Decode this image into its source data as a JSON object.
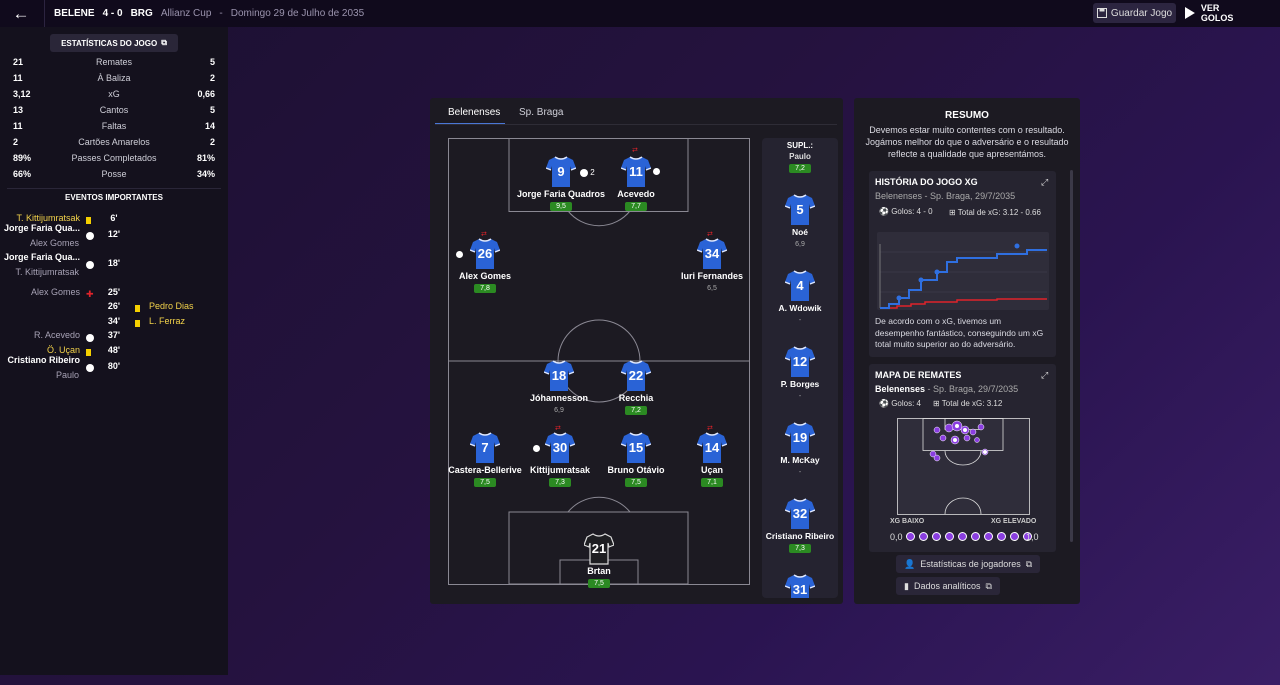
{
  "header": {
    "home_short": "BELENE",
    "score": "4 - 0",
    "away_short": "BRG",
    "competition": "Allianz Cup",
    "separator": "-",
    "date": "Domingo 29 de Julho de 2035",
    "save_label": "Guardar Jogo",
    "watch_label": "VER GOLOS"
  },
  "stats": {
    "button_label": "ESTATÍSTICAS DO JOGO",
    "rows": [
      {
        "home": "21",
        "label": "Remates",
        "away": "5"
      },
      {
        "home": "11",
        "label": "À Baliza",
        "away": "2"
      },
      {
        "home": "3,12",
        "label": "xG",
        "away": "0,66"
      },
      {
        "home": "13",
        "label": "Cantos",
        "away": "5"
      },
      {
        "home": "11",
        "label": "Faltas",
        "away": "14"
      },
      {
        "home": "2",
        "label": "Cartões Amarelos",
        "away": "2"
      },
      {
        "home": "89%",
        "label": "Passes Completados",
        "away": "81%"
      },
      {
        "home": "66%",
        "label": "Posse",
        "away": "34%"
      }
    ]
  },
  "events": {
    "title": "EVENTOS IMPORTANTES",
    "items": [
      {
        "home": "T. Kittijumratsak",
        "sub": "",
        "minute": "6'",
        "away": "",
        "icon": "yellow-card",
        "side": "home"
      },
      {
        "home": "Jorge Faria Qua...",
        "sub": "Alex Gomes",
        "minute": "12'",
        "away": "",
        "icon": "goal",
        "side": "home"
      },
      {
        "home": "Jorge Faria Qua...",
        "sub": "T. Kittijumratsak",
        "minute": "18'",
        "away": "",
        "icon": "goal",
        "side": "home"
      },
      {
        "home": "Alex Gomes",
        "sub": "",
        "minute": "25'",
        "away": "",
        "icon": "injury",
        "side": "home"
      },
      {
        "home": "",
        "sub": "",
        "minute": "26'",
        "away": "Pedro Dias",
        "icon": "yellow-card",
        "side": "away"
      },
      {
        "home": "",
        "sub": "",
        "minute": "34'",
        "away": "L. Ferraz",
        "icon": "yellow-card",
        "side": "away"
      },
      {
        "home": "R. Acevedo",
        "sub": "",
        "minute": "37'",
        "away": "",
        "icon": "goal",
        "side": "home"
      },
      {
        "home": "Ö. Uçan",
        "sub": "",
        "minute": "48'",
        "away": "",
        "icon": "yellow-card",
        "side": "home"
      },
      {
        "home": "Cristiano Ribeiro",
        "sub": "Paulo",
        "minute": "80'",
        "away": "",
        "icon": "goal",
        "side": "home"
      }
    ]
  },
  "pitch": {
    "tabs": [
      "Belenenses",
      "Sp. Braga"
    ],
    "subs_label": "SUPL.:",
    "players": [
      {
        "num": "9",
        "name": "Jorge Faria Quadros",
        "rating": "9,5"
      },
      {
        "num": "11",
        "name": "Acevedo",
        "rating": "7,7"
      },
      {
        "num": "26",
        "name": "Alex Gomes",
        "rating": "7,8"
      },
      {
        "num": "34",
        "name": "Iuri Fernandes",
        "rating": "6,5"
      },
      {
        "num": "18",
        "name": "Jóhannesson",
        "rating": "6,9"
      },
      {
        "num": "22",
        "name": "Recchia",
        "rating": "7,2"
      },
      {
        "num": "7",
        "name": "Castera-Bellerive",
        "rating": "7,5"
      },
      {
        "num": "30",
        "name": "Kittijumratsak",
        "rating": "7,3"
      },
      {
        "num": "15",
        "name": "Bruno Otávio",
        "rating": "7,5"
      },
      {
        "num": "14",
        "name": "Uçan",
        "rating": "7,1"
      },
      {
        "num": "21",
        "name": "Brtan",
        "rating": "7,5"
      }
    ],
    "goals_badge": "2",
    "subs": [
      {
        "num": "",
        "name": "Paulo",
        "rating": "7,2"
      },
      {
        "num": "5",
        "name": "Noé",
        "rating": "6,9"
      },
      {
        "num": "4",
        "name": "A. Wdowik",
        "rating": "-"
      },
      {
        "num": "12",
        "name": "P. Borges",
        "rating": "-"
      },
      {
        "num": "19",
        "name": "M. McKay",
        "rating": "-"
      },
      {
        "num": "32",
        "name": "Cristiano Ribeiro",
        "rating": "7,3"
      },
      {
        "num": "31",
        "name": "",
        "rating": ""
      }
    ]
  },
  "summary": {
    "title": "RESUMO",
    "text": "Devemos estar muito contentes com o resultado. Jogámos melhor do que o adversário e o resultado reflecte a qualidade que apresentámos.",
    "xg_title": "HISTÓRIA DO JOGO XG",
    "xg_sub": "Belenenses - Sp. Braga, 29/7/2035",
    "xg_goals": "Golos: 4 - 0",
    "xg_total": "Total de xG: 3.12 - 0.66",
    "xg_text": "De acordo com o xG, tivemos um desempenho fantástico, conseguindo um xG total muito superior ao do adversário.",
    "shot_title": "MAPA DE REMATES",
    "shot_team": "Belenenses",
    "shot_sub": " - Sp. Braga, 29/7/2035",
    "shot_goals": "Golos: 4",
    "shot_total": "Total de xG: 3.12",
    "xg_low": "XG BAIXO",
    "xg_high": "XG ELEVADO",
    "scale_min": "0,0",
    "scale_max": "1,0",
    "btn_players": "Estatísticas de jogadores",
    "btn_analytics": "Dados analíticos",
    "colors": {
      "home": "#2f6fe0",
      "away": "#e0232a",
      "accent": "#8a3ee0"
    }
  }
}
